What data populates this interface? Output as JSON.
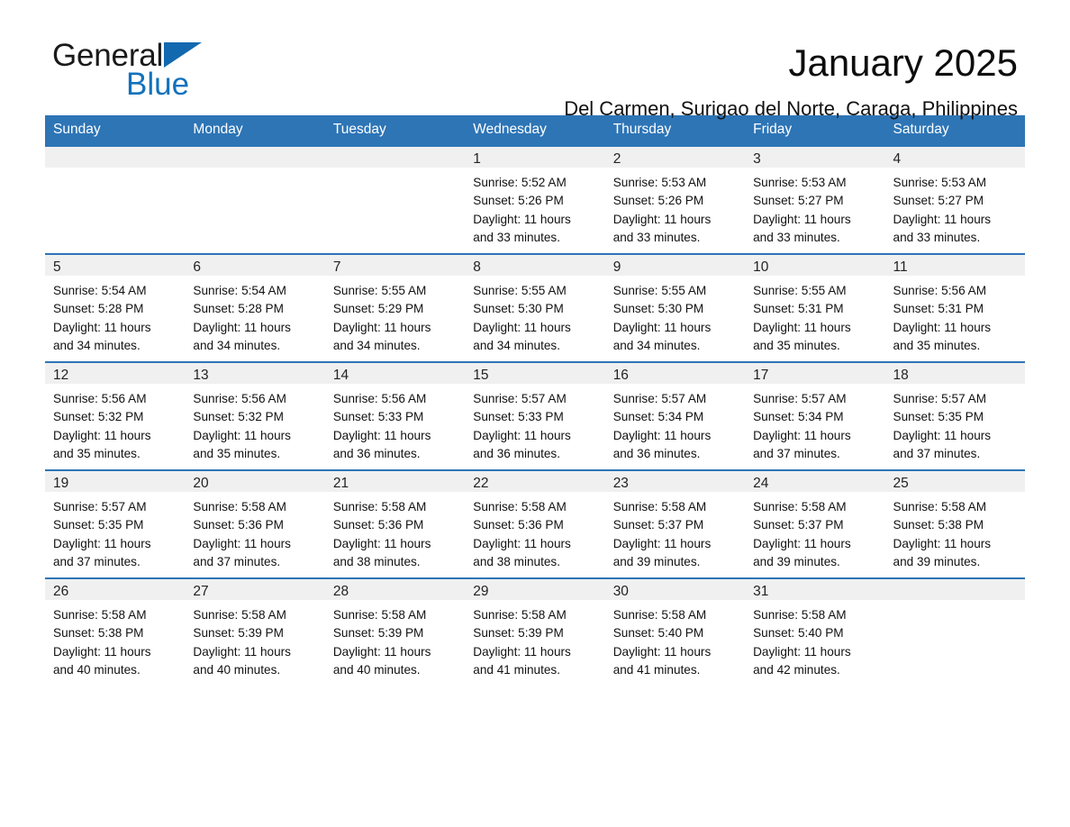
{
  "brand": {
    "word1": "General",
    "word2": "Blue",
    "flag_icon": "triangle-flag-icon",
    "accent_color": "#1272bc"
  },
  "header": {
    "title": "January 2025",
    "subtitle": "Del Carmen, Surigao del Norte, Caraga, Philippines"
  },
  "calendar": {
    "header_bg": "#2e75b6",
    "daynum_bg": "#f0f0f0",
    "weekday_headers": [
      "Sunday",
      "Monday",
      "Tuesday",
      "Wednesday",
      "Thursday",
      "Friday",
      "Saturday"
    ],
    "weeks": [
      [
        {
          "day": ""
        },
        {
          "day": ""
        },
        {
          "day": ""
        },
        {
          "day": "1",
          "sunrise": "Sunrise: 5:52 AM",
          "sunset": "Sunset: 5:26 PM",
          "daylight1": "Daylight: 11 hours",
          "daylight2": "and 33 minutes."
        },
        {
          "day": "2",
          "sunrise": "Sunrise: 5:53 AM",
          "sunset": "Sunset: 5:26 PM",
          "daylight1": "Daylight: 11 hours",
          "daylight2": "and 33 minutes."
        },
        {
          "day": "3",
          "sunrise": "Sunrise: 5:53 AM",
          "sunset": "Sunset: 5:27 PM",
          "daylight1": "Daylight: 11 hours",
          "daylight2": "and 33 minutes."
        },
        {
          "day": "4",
          "sunrise": "Sunrise: 5:53 AM",
          "sunset": "Sunset: 5:27 PM",
          "daylight1": "Daylight: 11 hours",
          "daylight2": "and 33 minutes."
        }
      ],
      [
        {
          "day": "5",
          "sunrise": "Sunrise: 5:54 AM",
          "sunset": "Sunset: 5:28 PM",
          "daylight1": "Daylight: 11 hours",
          "daylight2": "and 34 minutes."
        },
        {
          "day": "6",
          "sunrise": "Sunrise: 5:54 AM",
          "sunset": "Sunset: 5:28 PM",
          "daylight1": "Daylight: 11 hours",
          "daylight2": "and 34 minutes."
        },
        {
          "day": "7",
          "sunrise": "Sunrise: 5:55 AM",
          "sunset": "Sunset: 5:29 PM",
          "daylight1": "Daylight: 11 hours",
          "daylight2": "and 34 minutes."
        },
        {
          "day": "8",
          "sunrise": "Sunrise: 5:55 AM",
          "sunset": "Sunset: 5:30 PM",
          "daylight1": "Daylight: 11 hours",
          "daylight2": "and 34 minutes."
        },
        {
          "day": "9",
          "sunrise": "Sunrise: 5:55 AM",
          "sunset": "Sunset: 5:30 PM",
          "daylight1": "Daylight: 11 hours",
          "daylight2": "and 34 minutes."
        },
        {
          "day": "10",
          "sunrise": "Sunrise: 5:55 AM",
          "sunset": "Sunset: 5:31 PM",
          "daylight1": "Daylight: 11 hours",
          "daylight2": "and 35 minutes."
        },
        {
          "day": "11",
          "sunrise": "Sunrise: 5:56 AM",
          "sunset": "Sunset: 5:31 PM",
          "daylight1": "Daylight: 11 hours",
          "daylight2": "and 35 minutes."
        }
      ],
      [
        {
          "day": "12",
          "sunrise": "Sunrise: 5:56 AM",
          "sunset": "Sunset: 5:32 PM",
          "daylight1": "Daylight: 11 hours",
          "daylight2": "and 35 minutes."
        },
        {
          "day": "13",
          "sunrise": "Sunrise: 5:56 AM",
          "sunset": "Sunset: 5:32 PM",
          "daylight1": "Daylight: 11 hours",
          "daylight2": "and 35 minutes."
        },
        {
          "day": "14",
          "sunrise": "Sunrise: 5:56 AM",
          "sunset": "Sunset: 5:33 PM",
          "daylight1": "Daylight: 11 hours",
          "daylight2": "and 36 minutes."
        },
        {
          "day": "15",
          "sunrise": "Sunrise: 5:57 AM",
          "sunset": "Sunset: 5:33 PM",
          "daylight1": "Daylight: 11 hours",
          "daylight2": "and 36 minutes."
        },
        {
          "day": "16",
          "sunrise": "Sunrise: 5:57 AM",
          "sunset": "Sunset: 5:34 PM",
          "daylight1": "Daylight: 11 hours",
          "daylight2": "and 36 minutes."
        },
        {
          "day": "17",
          "sunrise": "Sunrise: 5:57 AM",
          "sunset": "Sunset: 5:34 PM",
          "daylight1": "Daylight: 11 hours",
          "daylight2": "and 37 minutes."
        },
        {
          "day": "18",
          "sunrise": "Sunrise: 5:57 AM",
          "sunset": "Sunset: 5:35 PM",
          "daylight1": "Daylight: 11 hours",
          "daylight2": "and 37 minutes."
        }
      ],
      [
        {
          "day": "19",
          "sunrise": "Sunrise: 5:57 AM",
          "sunset": "Sunset: 5:35 PM",
          "daylight1": "Daylight: 11 hours",
          "daylight2": "and 37 minutes."
        },
        {
          "day": "20",
          "sunrise": "Sunrise: 5:58 AM",
          "sunset": "Sunset: 5:36 PM",
          "daylight1": "Daylight: 11 hours",
          "daylight2": "and 37 minutes."
        },
        {
          "day": "21",
          "sunrise": "Sunrise: 5:58 AM",
          "sunset": "Sunset: 5:36 PM",
          "daylight1": "Daylight: 11 hours",
          "daylight2": "and 38 minutes."
        },
        {
          "day": "22",
          "sunrise": "Sunrise: 5:58 AM",
          "sunset": "Sunset: 5:36 PM",
          "daylight1": "Daylight: 11 hours",
          "daylight2": "and 38 minutes."
        },
        {
          "day": "23",
          "sunrise": "Sunrise: 5:58 AM",
          "sunset": "Sunset: 5:37 PM",
          "daylight1": "Daylight: 11 hours",
          "daylight2": "and 39 minutes."
        },
        {
          "day": "24",
          "sunrise": "Sunrise: 5:58 AM",
          "sunset": "Sunset: 5:37 PM",
          "daylight1": "Daylight: 11 hours",
          "daylight2": "and 39 minutes."
        },
        {
          "day": "25",
          "sunrise": "Sunrise: 5:58 AM",
          "sunset": "Sunset: 5:38 PM",
          "daylight1": "Daylight: 11 hours",
          "daylight2": "and 39 minutes."
        }
      ],
      [
        {
          "day": "26",
          "sunrise": "Sunrise: 5:58 AM",
          "sunset": "Sunset: 5:38 PM",
          "daylight1": "Daylight: 11 hours",
          "daylight2": "and 40 minutes."
        },
        {
          "day": "27",
          "sunrise": "Sunrise: 5:58 AM",
          "sunset": "Sunset: 5:39 PM",
          "daylight1": "Daylight: 11 hours",
          "daylight2": "and 40 minutes."
        },
        {
          "day": "28",
          "sunrise": "Sunrise: 5:58 AM",
          "sunset": "Sunset: 5:39 PM",
          "daylight1": "Daylight: 11 hours",
          "daylight2": "and 40 minutes."
        },
        {
          "day": "29",
          "sunrise": "Sunrise: 5:58 AM",
          "sunset": "Sunset: 5:39 PM",
          "daylight1": "Daylight: 11 hours",
          "daylight2": "and 41 minutes."
        },
        {
          "day": "30",
          "sunrise": "Sunrise: 5:58 AM",
          "sunset": "Sunset: 5:40 PM",
          "daylight1": "Daylight: 11 hours",
          "daylight2": "and 41 minutes."
        },
        {
          "day": "31",
          "sunrise": "Sunrise: 5:58 AM",
          "sunset": "Sunset: 5:40 PM",
          "daylight1": "Daylight: 11 hours",
          "daylight2": "and 42 minutes."
        },
        {
          "day": ""
        }
      ]
    ]
  }
}
